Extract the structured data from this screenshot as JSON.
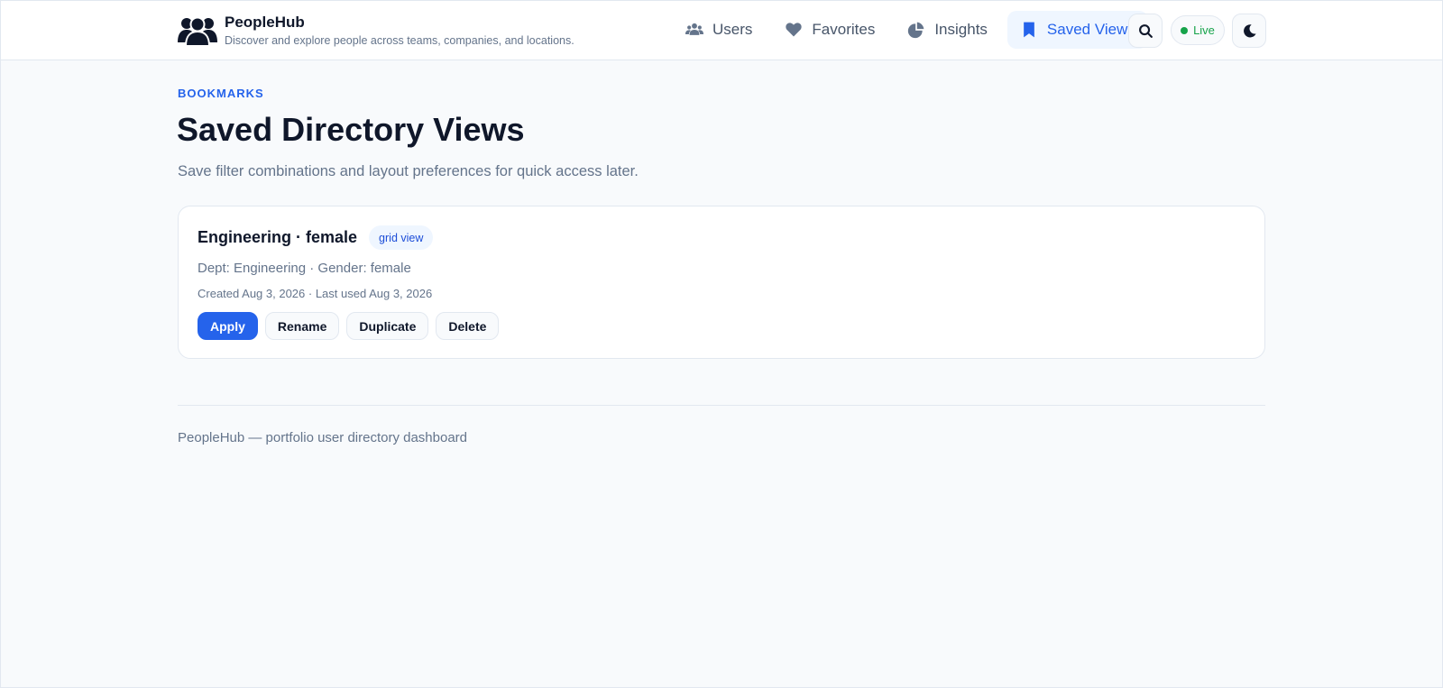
{
  "brand": {
    "name": "PeopleHub",
    "tagline": "Discover and explore people across teams, companies, and locations.",
    "logo_icon": "users-group-icon"
  },
  "nav": {
    "items": [
      {
        "label": "Users",
        "icon": "users-icon",
        "active": false
      },
      {
        "label": "Favorites",
        "icon": "heart-icon",
        "active": false
      },
      {
        "label": "Insights",
        "icon": "pie-chart-icon",
        "active": false
      },
      {
        "label": "Saved Views",
        "icon": "bookmark-icon",
        "active": true
      }
    ]
  },
  "toolbar": {
    "search_icon": "search-icon",
    "live_label": "Live",
    "theme_icon": "moon-icon"
  },
  "main": {
    "eyebrow": "BOOKMARKS",
    "title": "Saved Directory Views",
    "description": "Save filter combinations and layout preferences for quick access later."
  },
  "saved_views": [
    {
      "title": "Engineering · female",
      "tag": "grid view",
      "filters": "Dept: Engineering · Gender: female",
      "meta": "Created Aug 3, 2026 · Last used Aug 3, 2026",
      "actions": {
        "apply": "Apply",
        "rename": "Rename",
        "duplicate": "Duplicate",
        "delete": "Delete"
      }
    }
  ],
  "footer": {
    "text": "PeopleHub — portfolio user directory dashboard"
  },
  "colors": {
    "accent": "#2563eb",
    "live": "#16a34a",
    "background": "#f8fafc"
  }
}
